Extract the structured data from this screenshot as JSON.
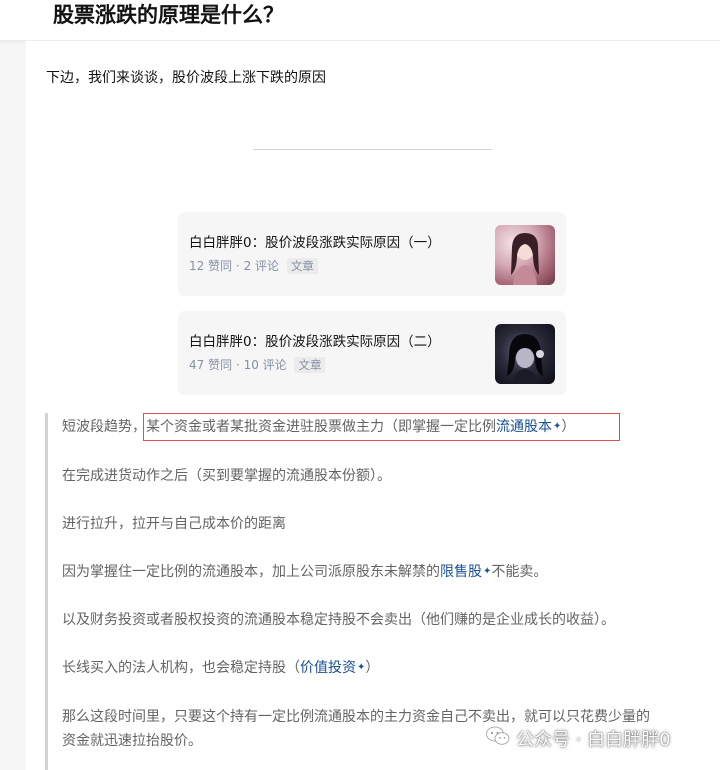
{
  "page": {
    "title": "股票涨跌的原理是什么？"
  },
  "answer": {
    "intro": "下边，我们来谈谈，股价波段上涨下跌的原因",
    "cards": [
      {
        "title": "白白胖胖0：股价波段涨跌实际原因（一）",
        "likes": "12 赞同",
        "comments": "2 评论",
        "tag": "文章"
      },
      {
        "title": "白白胖胖0：股价波段涨跌实际原因（二）",
        "likes": "47 赞同",
        "comments": "10 评论",
        "tag": "文章"
      }
    ],
    "quote": {
      "p1_lead": "短波段趋势",
      "p1_boxed": "，某个资金或者某批资金进驻股票做主力（即掌握一定比例",
      "p1_link": "流通股本",
      "p1_end": "）",
      "p2": "在完成进货动作之后（买到要掌握的流通股本份额）。",
      "p3": "进行拉升，拉开与自己成本价的距离",
      "p4_pre": "因为掌握住一定比例的流通股本，加上公司派原股东未解禁的",
      "p4_link": "限售股",
      "p4_post": "不能卖。",
      "p5": "以及财务投资或者股权投资的流通股本稳定持股不会卖出（他们赚的是企业成长的收益）。",
      "p6_pre": "长线买入的法人机构，也会稳定持股（",
      "p6_link": "价值投资",
      "p6_post": "）",
      "p7_line1": "那么这段时间里，只要这个持有一定比例流通股本的主力资金自己不卖出，就可以只花费少量的",
      "p7_line2": "资金就迅速拉抬股价。"
    }
  },
  "watermark": {
    "text": "公众号 · 白白胖胖0",
    "icon": "wechat-icon"
  },
  "colors": {
    "link": "#175199",
    "highlight_border": "#e34d4d",
    "quote_text": "#646464",
    "meta": "#8590a6"
  }
}
